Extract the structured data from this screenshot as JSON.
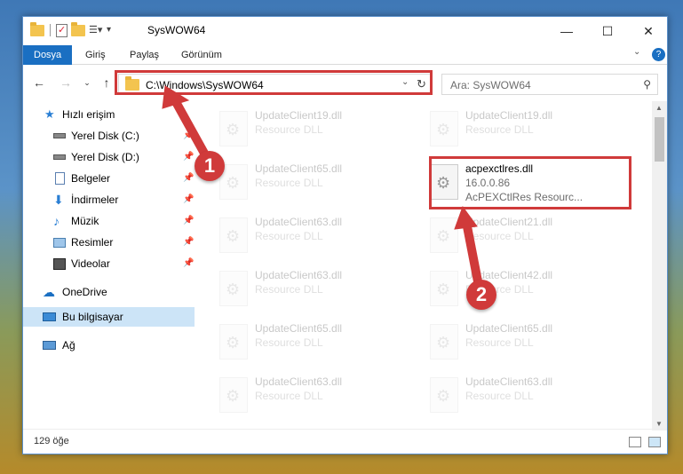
{
  "window": {
    "title": "SysWOW64",
    "controls": {
      "minimize": "—",
      "maximize": "☐",
      "close": "✕"
    }
  },
  "ribbon": {
    "tabs": [
      "Dosya",
      "Giriş",
      "Paylaş",
      "Görünüm"
    ],
    "active_tab": "Dosya"
  },
  "address": {
    "path": "C:\\Windows\\SysWOW64",
    "search_placeholder": "Ara: SysWOW64"
  },
  "nav": {
    "quick_access": "Hızlı erişim",
    "items": [
      {
        "label": "Yerel Disk (C:)",
        "icon": "drive-icon",
        "pinned": true
      },
      {
        "label": "Yerel Disk (D:)",
        "icon": "drive-icon",
        "pinned": true
      },
      {
        "label": "Belgeler",
        "icon": "documents-icon",
        "pinned": true
      },
      {
        "label": "İndirmeler",
        "icon": "download-icon",
        "pinned": true
      },
      {
        "label": "Müzik",
        "icon": "music-icon",
        "pinned": true
      },
      {
        "label": "Resimler",
        "icon": "pictures-icon",
        "pinned": true
      },
      {
        "label": "Videolar",
        "icon": "video-icon",
        "pinned": true
      }
    ],
    "onedrive": "OneDrive",
    "this_pc": "Bu bilgisayar",
    "network": "Ağ"
  },
  "files": {
    "left_column": [
      {
        "name": "UpdateClient19.dll",
        "desc": "Resource DLL"
      },
      {
        "name": "UpdateClient65.dll",
        "desc": "Resource DLL"
      },
      {
        "name": "UpdateClient63.dll",
        "desc": "Resource DLL"
      },
      {
        "name": "UpdateClient63.dll",
        "desc": "Resource DLL"
      },
      {
        "name": "UpdateClient65.dll",
        "desc": "Resource DLL"
      },
      {
        "name": "UpdateClient63.dll",
        "desc": "Resource DLL"
      }
    ],
    "right_column": [
      {
        "name": "UpdateClient19.dll",
        "desc": "Resource DLL"
      },
      {
        "name": "UpdateClient21.dll",
        "desc": "Resource DLL"
      },
      {
        "name": "UpdateClient42.dll",
        "desc": "Resource DLL"
      },
      {
        "name": "UpdateClient65.dll",
        "desc": "Resource DLL"
      },
      {
        "name": "UpdateClient63.dll",
        "desc": "Resource DLL"
      }
    ],
    "highlighted": {
      "name": "acpexctlres.dll",
      "version": "16.0.0.86",
      "desc": "AcPEXCtlRes Resourc..."
    }
  },
  "status": {
    "count": "129 öğe"
  },
  "annotations": {
    "step1": "1",
    "step2": "2",
    "color": "#d03a3a"
  }
}
